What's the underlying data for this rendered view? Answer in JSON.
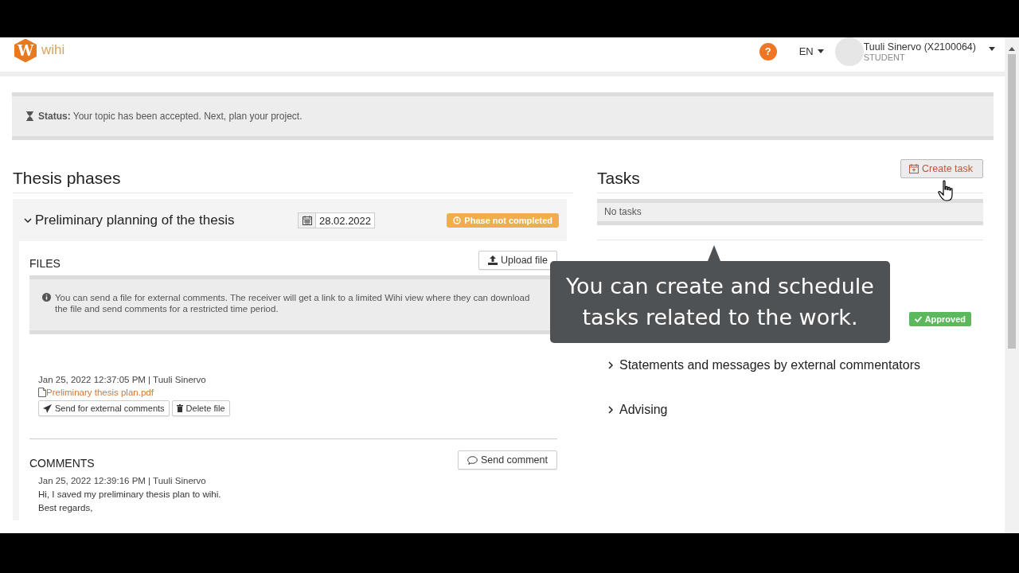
{
  "header": {
    "logo_letter": "W",
    "logo_text": "wihi",
    "help": "?",
    "language": "EN",
    "user_name": "Tuuli Sinervo (X2100064)",
    "user_role": "STUDENT"
  },
  "status": {
    "text": "**Status:** Your topic has been accepted. Next, plan your project."
  },
  "phases": {
    "title": "Thesis phases",
    "phase": {
      "title": "Preliminary planning of the thesis",
      "expanded": true,
      "date": "28.02.2022",
      "badge": "Phase not completed",
      "files": {
        "title": "FILES",
        "upload_button": "Upload file",
        "info": "You can send a file for external comments. The receiver will get a link to a limited Wihi view where they can download the file and send comments for a restricted time period.",
        "items": [
          {
            "meta": "Jan 25, 2022 12:37:05 PM | Tuuli Sinervo",
            "file_name": "Preliminary thesis plan.pdf",
            "send_button": "Send for external comments",
            "delete_button": "Delete file"
          }
        ]
      },
      "comments": {
        "title": "COMMENTS",
        "send_button": "Send comment",
        "items": [
          {
            "meta": "Jan 25, 2022 12:39:16 PM | Tuuli Sinervo",
            "lines": [
              "Hi, I saved my preliminary thesis plan to wihi.",
              "Best regards,"
            ]
          }
        ]
      }
    }
  },
  "tasks": {
    "title": "Tasks",
    "create_button": "Create task",
    "empty_text": "No tasks",
    "approved_badge": "Approved",
    "sections": [
      {
        "title": "Statements and messages by external commentators",
        "expanded": false
      },
      {
        "title": "Advising",
        "expanded": false
      }
    ]
  },
  "tooltip": {
    "text": "You can create and schedule tasks related to the work."
  }
}
